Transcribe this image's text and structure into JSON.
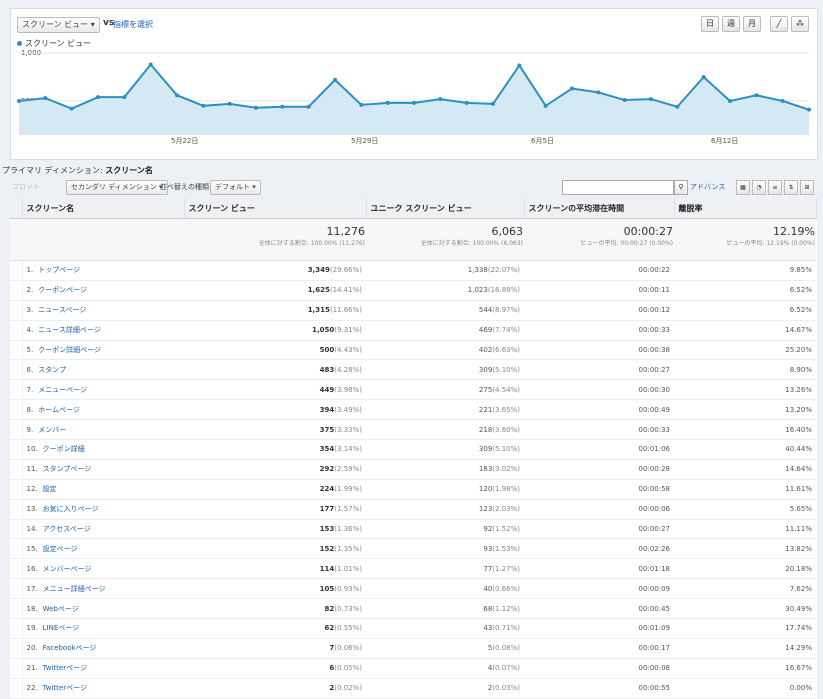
{
  "header": {
    "metric_select": "スクリーン ビュー",
    "vs": "vs",
    "pick_metric": "指標を選択",
    "time_buttons": [
      "日",
      "週",
      "月"
    ],
    "legend": "スクリーン ビュー",
    "ytick_high": "1,000",
    "ytick_low": "500",
    "x_ticks": [
      "5月22日",
      "5月29日",
      "6月5日",
      "6月12日"
    ]
  },
  "chart_data": {
    "type": "area",
    "series": [
      {
        "name": "スクリーン ビュー",
        "values": [
          500,
          530,
          420,
          540,
          540,
          880,
          560,
          450,
          470,
          430,
          440,
          440,
          720,
          460,
          480,
          480,
          520,
          480,
          470,
          870,
          450,
          630,
          590,
          510,
          520,
          440,
          750,
          500,
          560,
          500,
          410
        ]
      }
    ],
    "ylim": [
      0,
      1000
    ],
    "color": "#2c8fc4",
    "fill": "#d5e9f5"
  },
  "section": {
    "label": "プライマリ ディメンション:",
    "value": "スクリーン名"
  },
  "toolbar": {
    "disabled_label": "プロット",
    "secondary_dimension": "セカンダリ ディメンション",
    "sort_label": "並べ替えの種類:",
    "sort_value": "デフォルト",
    "advanced": "アドバンス"
  },
  "table": {
    "headers": [
      "スクリーン名",
      "スクリーン ビュー",
      "ユニーク スクリーン ビュー",
      "スクリーンの平均滞在時間",
      "離脱率"
    ],
    "totals": [
      {
        "value": "11,276",
        "sub": "全体に対する割合: 100.00% (11,276)"
      },
      {
        "value": "6,063",
        "sub": "全体に対する割合: 100.00% (6,063)"
      },
      {
        "value": "00:00:27",
        "sub": "ビューの平均: 00:00:27 (0.00%)"
      },
      {
        "value": "12.19%",
        "sub": "ビューの平均: 12.19% (0.00%)"
      }
    ],
    "rows": [
      {
        "idx": "1.",
        "name": "トップページ",
        "sv": "3,349",
        "svp": "(29.66%)",
        "usv": "1,338",
        "usvp": "(22.07%)",
        "time": "00:00:22",
        "exit": "9.85%"
      },
      {
        "idx": "2.",
        "name": "クーポンページ",
        "sv": "1,625",
        "svp": "(14.41%)",
        "usv": "1,023",
        "usvp": "(16.88%)",
        "time": "00:00:11",
        "exit": "6.52%"
      },
      {
        "idx": "3.",
        "name": "ニュースページ",
        "sv": "1,315",
        "svp": "(11.66%)",
        "usv": "544",
        "usvp": "(8.97%)",
        "time": "00:00:12",
        "exit": "6.52%"
      },
      {
        "idx": "4.",
        "name": "ニュース詳細ページ",
        "sv": "1,050",
        "svp": "(9.31%)",
        "usv": "469",
        "usvp": "(7.74%)",
        "time": "00:00:33",
        "exit": "14.67%"
      },
      {
        "idx": "5.",
        "name": "クーポン詳細ページ",
        "sv": "500",
        "svp": "(4.43%)",
        "usv": "402",
        "usvp": "(6.63%)",
        "time": "00:00:38",
        "exit": "25.20%"
      },
      {
        "idx": "6.",
        "name": "スタンプ",
        "sv": "483",
        "svp": "(4.28%)",
        "usv": "309",
        "usvp": "(5.10%)",
        "time": "00:00:27",
        "exit": "8.90%"
      },
      {
        "idx": "7.",
        "name": "メニューページ",
        "sv": "449",
        "svp": "(3.98%)",
        "usv": "275",
        "usvp": "(4.54%)",
        "time": "00:00:30",
        "exit": "13.26%"
      },
      {
        "idx": "8.",
        "name": "ホームページ",
        "sv": "394",
        "svp": "(3.49%)",
        "usv": "221",
        "usvp": "(3.65%)",
        "time": "00:00:49",
        "exit": "13.20%"
      },
      {
        "idx": "9.",
        "name": "メンバー",
        "sv": "375",
        "svp": "(3.33%)",
        "usv": "218",
        "usvp": "(3.60%)",
        "time": "00:00:33",
        "exit": "16.40%"
      },
      {
        "idx": "10.",
        "name": "クーポン詳細",
        "sv": "354",
        "svp": "(3.14%)",
        "usv": "309",
        "usvp": "(5.10%)",
        "time": "00:01:06",
        "exit": "40.44%"
      },
      {
        "idx": "11.",
        "name": "スタンプページ",
        "sv": "292",
        "svp": "(2.59%)",
        "usv": "183",
        "usvp": "(3.02%)",
        "time": "00:00:28",
        "exit": "14.64%"
      },
      {
        "idx": "12.",
        "name": "設定",
        "sv": "224",
        "svp": "(1.99%)",
        "usv": "120",
        "usvp": "(1.98%)",
        "time": "00:00:58",
        "exit": "11.61%"
      },
      {
        "idx": "13.",
        "name": "お気に入りページ",
        "sv": "177",
        "svp": "(1.57%)",
        "usv": "123",
        "usvp": "(2.03%)",
        "time": "00:00:06",
        "exit": "5.65%"
      },
      {
        "idx": "14.",
        "name": "アクセスページ",
        "sv": "153",
        "svp": "(1.36%)",
        "usv": "92",
        "usvp": "(1.52%)",
        "time": "00:00:27",
        "exit": "11.11%"
      },
      {
        "idx": "15.",
        "name": "設定ページ",
        "sv": "152",
        "svp": "(1.35%)",
        "usv": "93",
        "usvp": "(1.53%)",
        "time": "00:02:26",
        "exit": "13.82%"
      },
      {
        "idx": "16.",
        "name": "メンバーページ",
        "sv": "114",
        "svp": "(1.01%)",
        "usv": "77",
        "usvp": "(1.27%)",
        "time": "00:01:18",
        "exit": "20.18%"
      },
      {
        "idx": "17.",
        "name": "メニュー詳細ページ",
        "sv": "105",
        "svp": "(0.93%)",
        "usv": "40",
        "usvp": "(0.66%)",
        "time": "00:00:09",
        "exit": "7.62%"
      },
      {
        "idx": "18.",
        "name": "Webページ",
        "sv": "82",
        "svp": "(0.73%)",
        "usv": "68",
        "usvp": "(1.12%)",
        "time": "00:00:45",
        "exit": "30.49%"
      },
      {
        "idx": "19.",
        "name": "LINEページ",
        "sv": "62",
        "svp": "(0.55%)",
        "usv": "43",
        "usvp": "(0.71%)",
        "time": "00:01:09",
        "exit": "17.74%"
      },
      {
        "idx": "20.",
        "name": "Facebookページ",
        "sv": "7",
        "svp": "(0.06%)",
        "usv": "5",
        "usvp": "(0.08%)",
        "time": "00:00:17",
        "exit": "14.29%"
      },
      {
        "idx": "21.",
        "name": "Twitterページ",
        "sv": "6",
        "svp": "(0.05%)",
        "usv": "4",
        "usvp": "(0.07%)",
        "time": "00:00:08",
        "exit": "16.67%"
      },
      {
        "idx": "22.",
        "name": "Twitterページ",
        "sv": "2",
        "svp": "(0.02%)",
        "usv": "2",
        "usvp": "(0.03%)",
        "time": "00:00:55",
        "exit": "0.00%"
      }
    ]
  }
}
